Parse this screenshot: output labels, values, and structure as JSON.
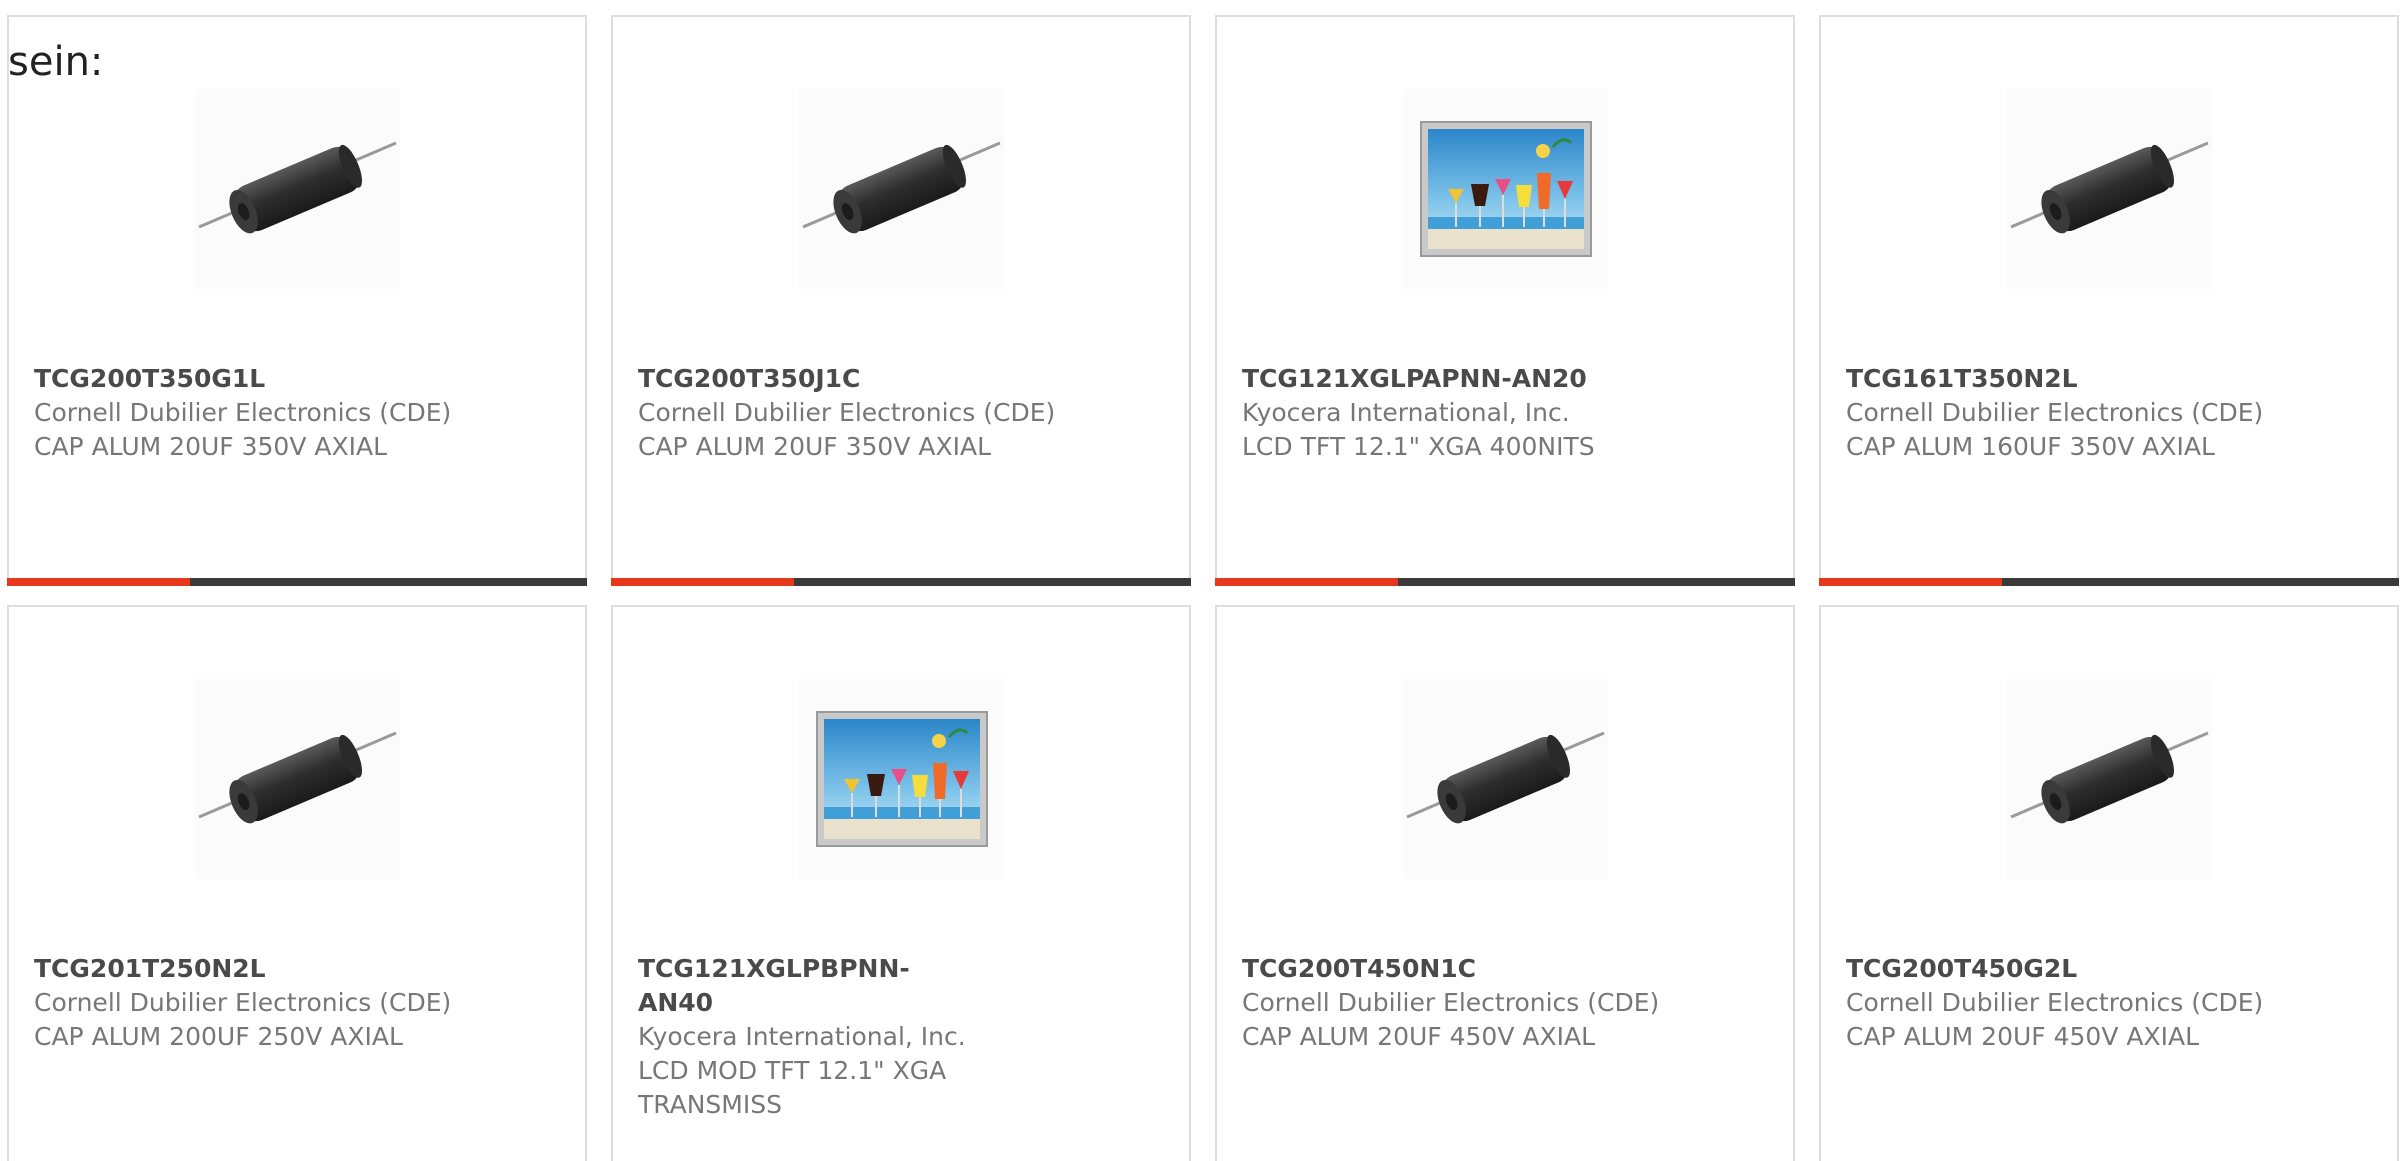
{
  "intro": "sein:",
  "accent_color": "#e8381c",
  "bar_color": "#3a3a3a",
  "products": [
    {
      "part": "TCG200T350G1L",
      "maker": "Cornell Dubilier Electronics (CDE)",
      "desc": "CAP ALUM 20UF 350V AXIAL",
      "image": "axial-capacitor-icon",
      "bar_progress": 0.315
    },
    {
      "part": "TCG200T350J1C",
      "maker": "Cornell Dubilier Electronics (CDE)",
      "desc": "CAP ALUM 20UF 350V AXIAL",
      "image": "axial-capacitor-icon",
      "bar_progress": 0.315
    },
    {
      "part": "TCG121XGLPAPNN-AN20",
      "maker": "Kyocera International, Inc.",
      "desc": "LCD TFT 12.1\" XGA 400NITS",
      "image": "lcd-display-icon",
      "bar_progress": 0.315
    },
    {
      "part": "TCG161T350N2L",
      "maker": "Cornell Dubilier Electronics (CDE)",
      "desc": "CAP ALUM 160UF 350V AXIAL",
      "image": "axial-capacitor-icon",
      "bar_progress": 0.315
    },
    {
      "part": "TCG201T250N2L",
      "maker": "Cornell Dubilier Electronics (CDE)",
      "desc": "CAP ALUM 200UF 250V AXIAL",
      "image": "axial-capacitor-icon"
    },
    {
      "part": "TCG121XGLPBPNN-AN40",
      "maker": "Kyocera International, Inc.",
      "desc": "LCD MOD TFT 12.1\" XGA TRANSMISS",
      "image": "lcd-display-icon"
    },
    {
      "part": "TCG200T450N1C",
      "maker": "Cornell Dubilier Electronics (CDE)",
      "desc": "CAP ALUM 20UF 450V AXIAL",
      "image": "axial-capacitor-icon"
    },
    {
      "part": "TCG200T450G2L",
      "maker": "Cornell Dubilier Electronics (CDE)",
      "desc": "CAP ALUM 20UF 450V AXIAL",
      "image": "axial-capacitor-icon"
    }
  ]
}
